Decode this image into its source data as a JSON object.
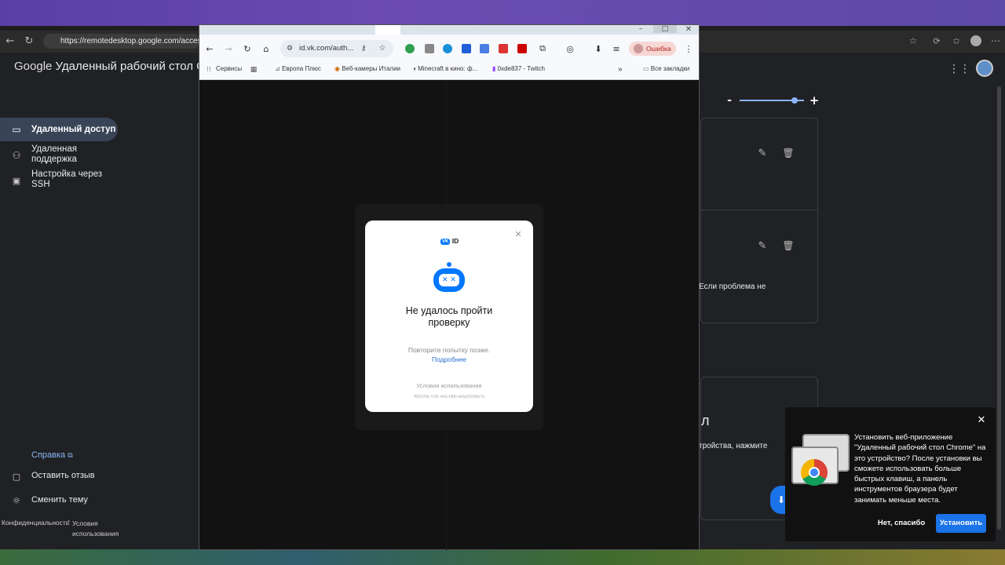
{
  "background_browser": {
    "url": "https://remotedesktop.google.com/access",
    "app_title": "Удаленный рабочий стол Chrome",
    "google_word": "Google"
  },
  "sidebar": {
    "items": [
      {
        "label": "Удаленный доступ"
      },
      {
        "label": "Удаленная поддержка"
      },
      {
        "label": "Настройка через SSH"
      }
    ],
    "help": "Справка",
    "feedback": "Оставить отзыв",
    "theme": "Сменить тему",
    "privacy": "Конфиденциальность",
    "bullet": "•",
    "terms": "Условия использования"
  },
  "main": {
    "zoom_minus": "-",
    "zoom_plus": "+",
    "zoom_level": 0.85,
    "partial_text_1": "Если проблема не",
    "partial_text_2": "тройства, нажмите",
    "partial_heading": "л"
  },
  "popup": {
    "url": "id.vk.com/auth...",
    "error_chip": "Ошибка",
    "bookmarks": [
      {
        "label": "Сервисы"
      },
      {
        "label": "Европа Плюс"
      },
      {
        "label": "Веб-камеры Италии"
      },
      {
        "label": "Minecraft в кино: ф..."
      },
      {
        "label": "0xde837 - Twitch"
      }
    ],
    "all_bookmarks": "Все закладки",
    "more": "»"
  },
  "vk_modal": {
    "brand_badge": "VK",
    "brand_id": "ID",
    "title": "Не удалось пройти проверку",
    "subtitle": "Повторите попытку позже.",
    "link": "Подробнее",
    "terms": "Условия использования",
    "code": "f6f027bb-7c91-4efc-b8f0-4e6e2509bb7d"
  },
  "install_prompt": {
    "text": "Установить веб-приложение \"Удаленный рабочий стол Chrome\" на это устройство? После установки вы сможете использовать больше быстрых клавиш, а панель инструментов браузера будет занимать меньше места.",
    "decline": "Нет, спасибо",
    "accept": "Установить"
  },
  "colors": {
    "accent_blue": "#1a73e8",
    "link_blue": "#8ab4f8",
    "vk_blue": "#0077ff"
  }
}
